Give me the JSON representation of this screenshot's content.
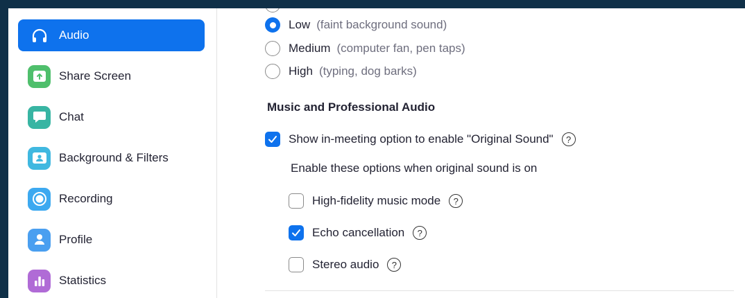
{
  "sidebar": {
    "items": [
      {
        "label": "Audio",
        "icon": "headphones-icon",
        "color": "#0e72ed",
        "active": true
      },
      {
        "label": "Share Screen",
        "icon": "share-screen-icon",
        "color": "#4fbf6c",
        "active": false
      },
      {
        "label": "Chat",
        "icon": "chat-icon",
        "color": "#38b5a3",
        "active": false
      },
      {
        "label": "Background & Filters",
        "icon": "background-icon",
        "color": "#40b8e0",
        "active": false
      },
      {
        "label": "Recording",
        "icon": "recording-icon",
        "color": "#3da9f0",
        "active": false
      },
      {
        "label": "Profile",
        "icon": "profile-icon",
        "color": "#4a9ff0",
        "active": false
      },
      {
        "label": "Statistics",
        "icon": "statistics-icon",
        "color": "#b06bd6",
        "active": false
      }
    ]
  },
  "noise_suppression": {
    "options": [
      {
        "label": "Low",
        "hint": "(faint background sound)",
        "checked": true
      },
      {
        "label": "Medium",
        "hint": "(computer fan, pen taps)",
        "checked": false
      },
      {
        "label": "High",
        "hint": "(typing, dog barks)",
        "checked": false
      }
    ]
  },
  "music_audio": {
    "title": "Music and Professional Audio",
    "original_sound": {
      "label": "Show in-meeting option to enable \"Original Sound\"",
      "checked": true
    },
    "note": "Enable these options when original sound is on",
    "options": [
      {
        "label": "High-fidelity music mode",
        "checked": false
      },
      {
        "label": "Echo cancellation",
        "checked": true
      },
      {
        "label": "Stereo audio",
        "checked": false
      }
    ],
    "help_glyph": "?"
  },
  "colors": {
    "accent": "#0e72ed",
    "page_background": "#0f3048"
  }
}
